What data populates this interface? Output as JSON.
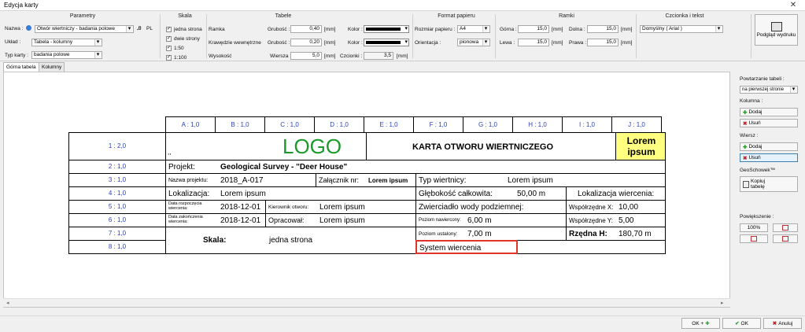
{
  "window": {
    "title": "Edycja karty"
  },
  "ribbon": {
    "parametry": {
      "title": "Parametry",
      "nazwa_label": "Nazwa :",
      "nazwa_value": "Otwór wiertniczy - badania polowe",
      "lang": "PL",
      "uklad_label": "Układ :",
      "uklad_value": "Tabela - kolumny",
      "typ_label": "Typ karty :",
      "typ_value": "badania polowe"
    },
    "skala": {
      "title": "Skala",
      "options": [
        "jedna strona",
        "dwie strony",
        "1:50",
        "1:100"
      ]
    },
    "tabele": {
      "title": "Tabele",
      "ramka": "Ramka",
      "krawedzie": "Krawędzie wewnętrzne",
      "wysokosc": "Wysokość",
      "grubosc_label": "Grubość :",
      "grubosc1": "0,40",
      "grubosc2": "0,20",
      "wiersza_label": "Wiersza :",
      "wiersza": "5,0",
      "unit": "[mm]",
      "kolor_label": "Kolor :",
      "czcionki_label": "Czcionki :",
      "czcionki": "3,5"
    },
    "format": {
      "title": "Format papieru",
      "rozmiar_label": "Rozmiar papieru :",
      "rozmiar": "A4",
      "orientacja_label": "Orientacja :",
      "orientacja": "pionowa"
    },
    "ramki": {
      "title": "Ramki",
      "gorna_label": "Górna :",
      "gorna": "15,0",
      "dolna_label": "Dolna :",
      "dolna": "15,0",
      "lewa_label": "Lewa :",
      "lewa": "15,0",
      "prawa_label": "Prawa :",
      "prawa": "15,0",
      "unit": "[mm]"
    },
    "czcionka": {
      "title": "Czcionka i tekst",
      "value": "Domyślny ( Arial )"
    },
    "podglad": "Podgląd wydruku"
  },
  "tabs": [
    "Górna tabela",
    "Kolumny"
  ],
  "sheet": {
    "col_headers": [
      "A : 1,0",
      "B : 1,0",
      "C : 1,0",
      "D : 1,0",
      "E : 1,0",
      "F : 1,0",
      "G : 1,0",
      "H : 1,0",
      "I : 1,0",
      "J : 1,0"
    ],
    "row_headers": [
      "1 : 2,0",
      "2 : 1,0",
      "3 : 1,0",
      "4 : 1,0",
      "5 : 1,0",
      "6 : 1,0",
      "7 : 1,0",
      "8 : 1,0"
    ],
    "logo": "LOGO",
    "commas": ",,",
    "title": "KARTA OTWORU WIERTNICZEGO",
    "lorem_box": "Lorem ipsum",
    "projekt_label": "Projekt:",
    "projekt": "Geological Survey - \"Deer House\"",
    "nazwa_projektu_label": "Nazwa projektu:",
    "nazwa_projektu": "2018_A-017",
    "zalacznik_label": "Załącznik nr:",
    "zalacznik": "Lorem ipsum",
    "typ_wiertnicy_label": "Typ wiertnicy:",
    "typ_wiertnicy": "Lorem ipsum",
    "lokalizacja_label": "Lokalizacja:",
    "lokalizacja": "Lorem ipsum",
    "glebokosc_label": "Głębokość całkowita:",
    "glebokosc": "50,00 m",
    "lok_wiercenia": "Lokalizacja wiercenia:",
    "data_rozp_label": "Data rozpoczęcia wiercenia:",
    "data_rozp": "2018-12-01",
    "kierownik_label": "Kierownik otworu:",
    "kierownik": "Lorem ipsum",
    "zwierciadlo": "Zwierciadło wody podziemnej:",
    "wsp_x_label": "Współrzędne X:",
    "wsp_x": "10,00",
    "data_zak_label": "Data zakończenia wiercenia:",
    "data_zak": "2018-12-01",
    "opracowal_label": "Opracował:",
    "opracowal": "Lorem ipsum",
    "poziom_naw_label": "Poziom nawiercony:",
    "poziom_naw": "6,00 m",
    "wsp_y_label": "Współrzędne Y:",
    "wsp_y": "5,00",
    "skala_label": "Skala:",
    "skala": "jedna strona",
    "poziom_ust_label": "Poziom ustalony:",
    "poziom_ust": "7,00 m",
    "rzedna_label": "Rzędna H:",
    "rzedna": "180,70 m",
    "system": "System wiercenia"
  },
  "right_panel": {
    "powtarzanie_label": "Powtarzanie tabeli :",
    "powtarzanie": "na pierwszej stronie",
    "kolumna_label": "Kolumna :",
    "dodaj": "Dodaj",
    "usun": "Usuń",
    "wiersz_label": "Wiersz :",
    "geoschowek": "GeoSchowek™",
    "kopiuj": "Kopiuj tabelę",
    "powiekszenie": "Powiększenie :",
    "zoom": "100%"
  },
  "bottom": {
    "okplus": "OK +",
    "ok": "OK",
    "anuluj": "Anuluj"
  },
  "colors": {
    "logo": "#1a9a2a",
    "yellow": "#ffff80",
    "highlight": "#e0332a",
    "header_text": "#2a3fbf"
  }
}
